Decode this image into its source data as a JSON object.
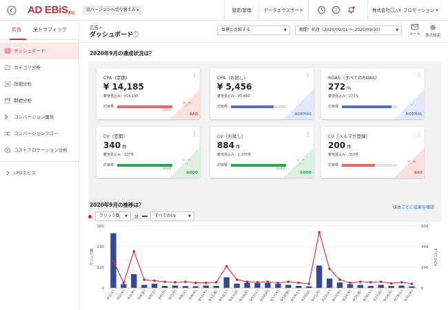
{
  "topbar": {
    "logo": "AD EBiS.",
    "logo_sub": "β版",
    "old_version_btn": "旧バージョンへ切り替える ▸",
    "nav_settings": "設定/管理",
    "nav_export": "データエクスポート",
    "company": "株式会社〇△× プロモーション ▾"
  },
  "sidebar": {
    "tabs": [
      "広告",
      "全トラフィック"
    ],
    "items": [
      {
        "label": "ダッシュボード",
        "icon": "grid-icon"
      },
      {
        "label": "カテゴリ分析",
        "icon": "folder-icon"
      },
      {
        "label": "詳細分析",
        "icon": "list-icon"
      },
      {
        "label": "期間分析",
        "icon": "calendar-icon"
      },
      {
        "label": "コンバージョン属性",
        "icon": "tag-icon"
      },
      {
        "label": "コンバージョンフロー",
        "icon": "flow-icon"
      },
      {
        "label": "コストアロケーション分析",
        "icon": "coins-icon"
      }
    ],
    "lpo": "LPOエビス"
  },
  "header": {
    "breadcrumb": "広告>",
    "title": "ダッシュボード",
    "compare_select": "目標と比較する",
    "period_select": "期間：前月（2020/09/01 ～ 2020/09/30）",
    "mail_label": "メール",
    "settings_label": "表示設定"
  },
  "main": {
    "section1": "2020年9月の達成状況は？",
    "section2": "2020年9月の推移は？",
    "link_media": "媒体ごとに成果を確認",
    "target_label": "対目標",
    "metric_select": "クリック数",
    "versus": "対",
    "cv_select": "すべてのCV"
  },
  "cards": [
    {
      "title": "CPA（定期）",
      "value": "¥ 14,185",
      "unit": "",
      "forecast": "着地見込み：¥14,185",
      "status": "BAD",
      "face": ">_<",
      "progress": 1.0,
      "over": "OVER",
      "bar_color": "#e06c6c",
      "tri_color": "#fbe0e0",
      "status_color": "#e05050"
    },
    {
      "title": "CPA（お試し）",
      "value": "¥ 5,456",
      "unit": "",
      "forecast": "着地見込み：¥5,456",
      "status": "NORMAL",
      "face": "'_'",
      "progress": 0.78,
      "over": "",
      "bar_color": "#5470c6",
      "tri_color": "#e3e9fa",
      "status_color": "#6b85d8"
    },
    {
      "title": "ROAS（すべてのROAS）",
      "value": "272",
      "unit": "%",
      "forecast": "着地見込み：272%",
      "status": "NORMAL",
      "face": "'_'",
      "progress": 0.9,
      "over": "",
      "bar_color": "#5470c6",
      "tri_color": "#e3e9fa",
      "status_color": "#6b85d8"
    },
    {
      "title": "CV（定期）",
      "value": "340",
      "unit": "件",
      "forecast": "着地見込み：327件",
      "status": "GOOD",
      "face": "^_^",
      "progress": 1.0,
      "over": "OVER",
      "bar_color": "#2aa44a",
      "tri_color": "#dcf1e0",
      "status_color": "#2aa44a"
    },
    {
      "title": "CV（お試し）",
      "value": "884",
      "unit": "件",
      "forecast": "着地見込み：1,370件",
      "status": "GOOD",
      "face": "^_^",
      "progress": 1.0,
      "over": "OVER",
      "bar_color": "#2aa44a",
      "tri_color": "#dcf1e0",
      "status_color": "#2aa44a"
    },
    {
      "title": "CV（メルマガ登録）",
      "value": "200",
      "unit": "件",
      "forecast": "着地見込み：310件",
      "status": "BAD",
      "face": ">_<",
      "progress": 0.6,
      "over": "",
      "bar_color": "#e06c6c",
      "tri_color": "#fbe0e0",
      "status_color": "#e05050"
    }
  ],
  "chart_data": {
    "type": "bar",
    "categories": [
      "9/1(火)",
      "9/2(水)",
      "9/3(木)",
      "9/4(金)",
      "9/5(土)",
      "9/6(日)",
      "9/7(月)",
      "9/8(火)",
      "9/9(水)",
      "9/10(木)",
      "9/11(金)",
      "9/12(土)",
      "9/13(日)",
      "9/14(月)",
      "9/15(火)",
      "9/16(水)",
      "9/17(木)",
      "9/18(金)",
      "9/19(土)",
      "9/20(日)",
      "9/21(月)",
      "9/22(火)",
      "9/23(水)",
      "9/24(木)",
      "9/25(金)",
      "9/26(土)",
      "9/27(日)",
      "9/28(月)",
      "9/29(火)",
      "9/30(水)"
    ],
    "series": [
      {
        "name": "クリック数",
        "type": "bar",
        "axis": "left",
        "color": "#34489a",
        "values": [
          318,
          22,
          80,
          18,
          25,
          12,
          14,
          11,
          10,
          14,
          12,
          62,
          25,
          30,
          28,
          30,
          24,
          18,
          12,
          10,
          130,
          55,
          32,
          22,
          18,
          12,
          18,
          12,
          14,
          10
        ]
      },
      {
        "name": "すべてのCV",
        "type": "line",
        "axis": "right",
        "color": "#d8242c",
        "values": [
          260,
          50,
          355,
          80,
          70,
          60,
          55,
          60,
          50,
          50,
          55,
          210,
          80,
          60,
          55,
          60,
          50,
          60,
          50,
          40,
          540,
          185,
          80,
          50,
          60,
          55,
          60,
          45,
          55,
          40
        ]
      }
    ],
    "ylabel_left": "クリック数",
    "ylabel_right": "すべてのCV",
    "ylim_left": [
      0,
      360
    ],
    "yticks_left": [
      0,
      120,
      240,
      360
    ],
    "ylim_right": [
      0,
      600
    ],
    "yticks_right": [
      0,
      200,
      400,
      600
    ]
  },
  "colors": {
    "accent": "#d22c36",
    "link": "#2a6fdb"
  }
}
